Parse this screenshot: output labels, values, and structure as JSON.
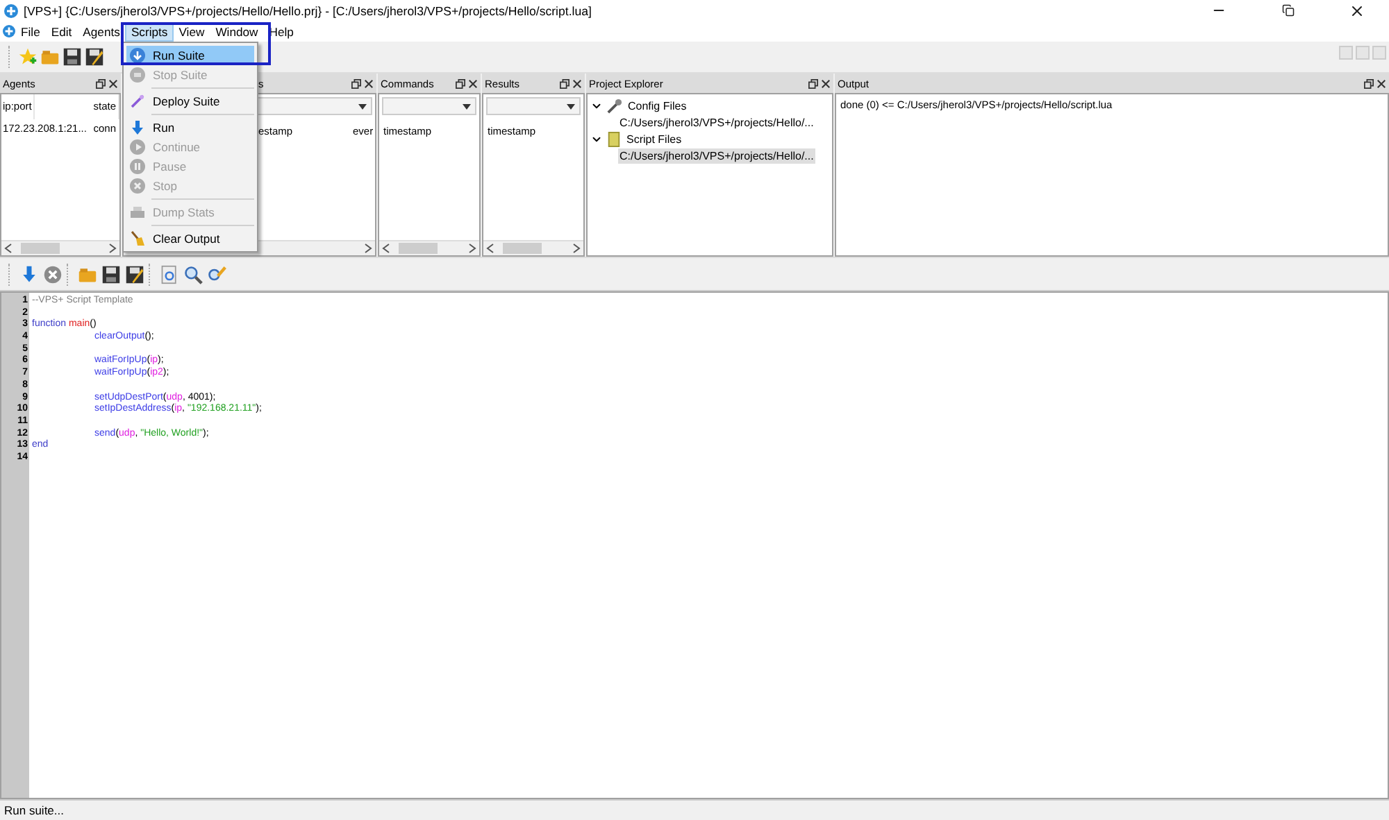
{
  "window": {
    "title": "[VPS+] {C:/Users/jherol3/VPS+/projects/Hello/Hello.prj} - [C:/Users/jherol3/VPS+/projects/Hello/script.lua]"
  },
  "menu_bar": [
    {
      "label": "File",
      "selected": false
    },
    {
      "label": "Edit",
      "selected": false
    },
    {
      "label": "Agents",
      "selected": false
    },
    {
      "label": "Scripts",
      "selected": true
    },
    {
      "label": "View",
      "selected": false
    },
    {
      "label": "Window",
      "selected": false
    },
    {
      "label": "Help",
      "selected": false
    }
  ],
  "scripts_menu": [
    {
      "kind": "item",
      "label": "Run Suite",
      "disabled": false,
      "selected": true
    },
    {
      "kind": "item",
      "label": "Stop Suite",
      "disabled": true,
      "selected": false
    },
    {
      "kind": "separator"
    },
    {
      "kind": "item",
      "label": "Deploy Suite",
      "disabled": false,
      "selected": false
    },
    {
      "kind": "separator"
    },
    {
      "kind": "item",
      "label": "Run",
      "disabled": false,
      "selected": false
    },
    {
      "kind": "item",
      "label": "Continue",
      "disabled": true,
      "selected": false
    },
    {
      "kind": "item",
      "label": "Pause",
      "disabled": true,
      "selected": false
    },
    {
      "kind": "item",
      "label": "Stop",
      "disabled": true,
      "selected": false
    },
    {
      "kind": "separator"
    },
    {
      "kind": "item",
      "label": "Dump Stats",
      "disabled": true,
      "selected": false
    },
    {
      "kind": "separator"
    },
    {
      "kind": "item",
      "label": "Clear Output",
      "disabled": false,
      "selected": false
    }
  ],
  "panels": [
    {
      "kind": "table",
      "title": "Agents",
      "columns": [
        "ip:port",
        "state"
      ],
      "rows": [
        [
          "172.23.208.1:21...",
          "conn"
        ]
      ]
    },
    {
      "kind": "log",
      "title": "s",
      "rows": [
        [
          "estamp",
          "ever"
        ]
      ]
    },
    {
      "kind": "log",
      "title": "Commands",
      "rows": [
        [
          "timestamp"
        ]
      ]
    },
    {
      "kind": "log",
      "title": "Results",
      "rows": [
        [
          "timestamp"
        ]
      ]
    },
    {
      "kind": "tree",
      "title": "Project Explorer",
      "nodes": [
        {
          "label": "Config Files",
          "expanded": true,
          "children": [
            {
              "label": "C:/Users/jherol3/VPS+/projects/Hello/...",
              "selected": false
            }
          ]
        },
        {
          "label": "Script Files",
          "expanded": true,
          "children": [
            {
              "label": "C:/Users/jherol3/VPS+/projects/Hello/...",
              "selected": true
            }
          ]
        }
      ]
    },
    {
      "kind": "output",
      "title": "Output",
      "lines": [
        "done (0) <= C:/Users/jherol3/VPS+/projects/Hello/script.lua"
      ]
    }
  ],
  "editor": {
    "lines": [
      {
        "number": "1",
        "indent": false,
        "tokens": [
          {
            "kind": "comment",
            "text": "--VPS+ Script Template"
          }
        ]
      },
      {
        "number": "2"
      },
      {
        "number": "3",
        "indent": false,
        "tokens": [
          {
            "kind": "keyword",
            "text": "function "
          },
          {
            "kind": "name",
            "text": "main"
          },
          {
            "kind": "plain",
            "text": "()"
          }
        ]
      },
      {
        "number": "4",
        "indent": true,
        "tokens": [
          {
            "kind": "call",
            "text": "clearOutput"
          },
          {
            "kind": "plain",
            "text": "();"
          }
        ]
      },
      {
        "number": "5"
      },
      {
        "number": "6",
        "indent": true,
        "tokens": [
          {
            "kind": "call",
            "text": "waitForIpUp"
          },
          {
            "kind": "plain",
            "text": "("
          },
          {
            "kind": "param",
            "text": "ip"
          },
          {
            "kind": "plain",
            "text": ");"
          }
        ]
      },
      {
        "number": "7",
        "indent": true,
        "tokens": [
          {
            "kind": "call",
            "text": "waitForIpUp"
          },
          {
            "kind": "plain",
            "text": "("
          },
          {
            "kind": "param",
            "text": "ip2"
          },
          {
            "kind": "plain",
            "text": ");"
          }
        ]
      },
      {
        "number": "8"
      },
      {
        "number": "9",
        "indent": true,
        "tokens": [
          {
            "kind": "call",
            "text": "setUdpDestPort"
          },
          {
            "kind": "plain",
            "text": "("
          },
          {
            "kind": "param",
            "text": "udp"
          },
          {
            "kind": "plain",
            "text": ", 4001);"
          }
        ]
      },
      {
        "number": "10",
        "indent": true,
        "tokens": [
          {
            "kind": "call",
            "text": "setIpDestAddress"
          },
          {
            "kind": "plain",
            "text": "("
          },
          {
            "kind": "param",
            "text": "ip"
          },
          {
            "kind": "plain",
            "text": ", "
          },
          {
            "kind": "string",
            "text": "\"192.168.21.11\""
          },
          {
            "kind": "plain",
            "text": ");"
          }
        ]
      },
      {
        "number": "11"
      },
      {
        "number": "12",
        "indent": true,
        "tokens": [
          {
            "kind": "call",
            "text": "send"
          },
          {
            "kind": "plain",
            "text": "("
          },
          {
            "kind": "param",
            "text": "udp"
          },
          {
            "kind": "plain",
            "text": ", "
          },
          {
            "kind": "string",
            "text": "\"Hello, World!\""
          },
          {
            "kind": "plain",
            "text": ");"
          }
        ]
      },
      {
        "number": "13",
        "indent": false,
        "tokens": [
          {
            "kind": "keyword",
            "text": "end"
          }
        ]
      },
      {
        "number": "14"
      }
    ]
  },
  "status_bar": "Run suite..."
}
